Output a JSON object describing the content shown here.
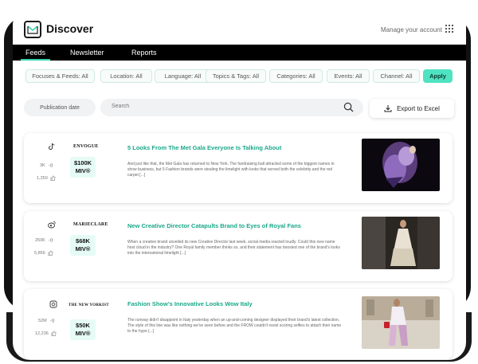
{
  "header": {
    "title": "Discover",
    "account_link": "Manage your account"
  },
  "nav": {
    "tabs": [
      {
        "label": "Feeds",
        "active": true
      },
      {
        "label": "Newsletter",
        "active": false
      },
      {
        "label": "Reports",
        "active": false
      }
    ]
  },
  "filters": {
    "chips": [
      "Focuses & Feeds: All",
      "Location: All",
      "Language: All",
      "Topics & Tags: All",
      "Categories: All",
      "Events: All",
      "Channel: All"
    ],
    "apply_label": "Apply"
  },
  "search": {
    "date_label": "Publication date",
    "placeholder": "Search",
    "export_label": "Export to Excel"
  },
  "colors": {
    "accent": "#34d3b0",
    "apply_bg": "#4fe3c1",
    "title_green": "#1aa88a",
    "miv_bg": "#e6fbf5"
  },
  "articles": [
    {
      "social_icon": "tiktok-icon",
      "outlet": "ENVOGUE",
      "reach": "3K",
      "likes": "1,250",
      "miv_value": "$100K",
      "miv_label": "MIV®",
      "title": "5 Looks From The Met Gala Everyone Is Talking About",
      "excerpt": "And just like that, the Met Gala has returned to New York. The fundraising ball attracted some of the biggest names in show business, but 5 Fashion brands were stealing the limelight with looks that served both the celebrity and the red carpet [...]"
    },
    {
      "social_icon": "weibo-icon",
      "outlet": "MARIECLARE",
      "reach": "250K",
      "likes": "5,856",
      "miv_value": "$68K",
      "miv_label": "MIV®",
      "title": "New Creative Director Catapults Brand to Eyes of Royal Fans",
      "excerpt": "When a creative brand unveiled its new Creative Director last week, social media reacted loudly. Could this new name host cloud in the industry? One Royal family member thinks so, and their statement has boosted one of the brand's looks into the international limelight [...]"
    },
    {
      "social_icon": "instagram-icon",
      "outlet": "THE NEW YORKIST",
      "reach": "52M",
      "likes": "12,236",
      "miv_value": "$50K",
      "miv_label": "MIV®",
      "title": "Fashion Show's Innovative Looks Wow Italy",
      "excerpt": "The runway didn't disappoint in Italy yesterday when an up-and-coming designer displayed their brand's latest collection. The style of this line was like nothing we've seen before and the FROW couldn't resist scoring selfies to attach their name to the hype [...]"
    }
  ]
}
